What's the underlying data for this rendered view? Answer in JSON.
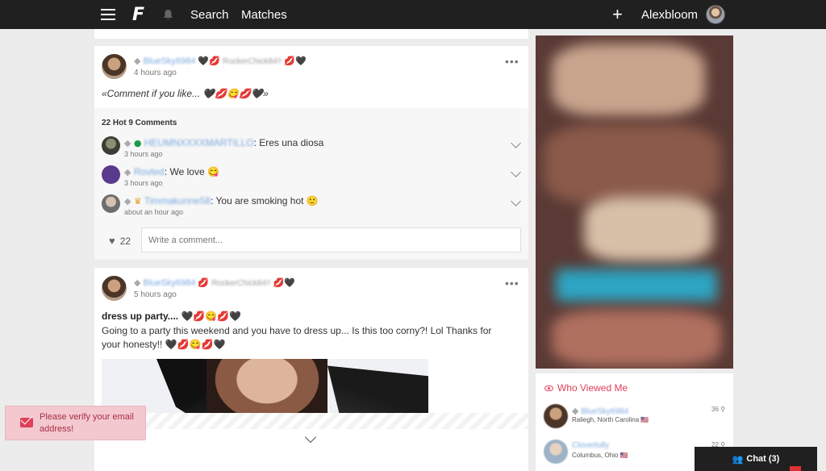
{
  "nav": {
    "search_label": "Search",
    "matches_label": "Matches",
    "username": "Alexbloom"
  },
  "post1": {
    "author": "BlueSky6984",
    "tagged": "RockerChick84!!",
    "time": "4 hours ago",
    "text": "«Comment if you like... 🖤💋😋💋🖤»",
    "counts": "22 Hot  9 Comments",
    "comments": [
      {
        "user": "HEUMNXXXXMARTILLO",
        "text": ": Eres una diosa",
        "time": "3 hours ago"
      },
      {
        "user": "Rovted",
        "text": ": We love 😋",
        "time": "3 hours ago"
      },
      {
        "user": "Timmakunne58",
        "text": ": You are smoking hot 🙂",
        "time": "about an hour ago"
      }
    ],
    "like_count": "22",
    "comment_placeholder": "Write a comment..."
  },
  "post2": {
    "author": "BlueSky6984",
    "tagged": "RockerChick84!!",
    "time": "5 hours ago",
    "title": "dress up party.... 🖤💋😋💋🖤",
    "body": "Going to a party this weekend and you have to dress up... Is this too corny?! Lol Thanks for your honesty!! 🖤💋😋💋🖤"
  },
  "who_viewed": {
    "title": "Who Viewed Me",
    "viewers": [
      {
        "name": "BlueSky6984",
        "location": "Raliegh, North Carolina 🇺🇸",
        "distance": "36 ⚲"
      },
      {
        "name": "Cloverlolly",
        "location": "Columbus, Ohio 🇺🇸",
        "distance": "22 ⚲"
      }
    ]
  },
  "toast": {
    "message": "Please verify your email address!"
  },
  "chat": {
    "label": "Chat (3)"
  },
  "colors": {
    "nav_bg": "#202020",
    "accent": "#e0405a",
    "link_blue": "#7aa8e0"
  }
}
